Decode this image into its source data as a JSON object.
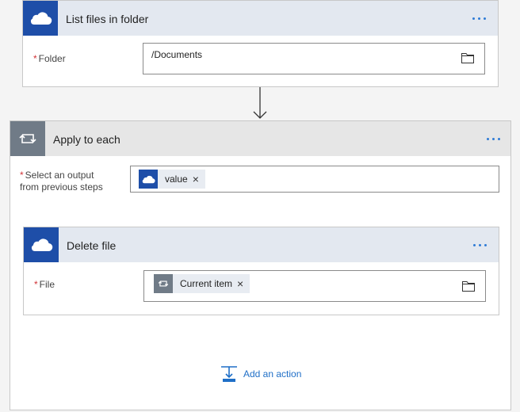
{
  "list_card": {
    "title": "List files in folder",
    "folder": {
      "label": "Folder",
      "value": "/Documents"
    }
  },
  "apply_card": {
    "title": "Apply to each",
    "output": {
      "label_line1": "Select an output",
      "label_line2": "from previous steps",
      "token": "value"
    }
  },
  "delete_card": {
    "title": "Delete file",
    "file": {
      "label": "File",
      "token": "Current item"
    }
  },
  "add_action": {
    "label": "Add an action"
  },
  "icons": {
    "onedrive": "cloud-icon",
    "loop": "loop-icon",
    "folder": "folder-icon",
    "more": "more-options-icon",
    "add": "add-action-icon",
    "remove": "close-icon"
  },
  "colors": {
    "accent": "#1e4ea8",
    "link": "#1f6fc7",
    "required": "#d13438",
    "loop": "#707b87"
  }
}
